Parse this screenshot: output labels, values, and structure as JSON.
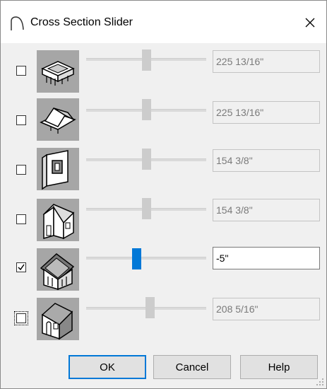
{
  "window": {
    "title": "Cross Section Slider"
  },
  "rows": [
    {
      "value": "225 13/16\"",
      "checked": false,
      "icon": "roof-plan-icon"
    },
    {
      "value": "225 13/16\"",
      "checked": false,
      "icon": "roof-3d-icon"
    },
    {
      "value": "154 3/8\"",
      "checked": false,
      "icon": "wall-section-icon"
    },
    {
      "value": "154 3/8\"",
      "checked": false,
      "icon": "house-side-icon"
    },
    {
      "value": "-5\"",
      "checked": true,
      "icon": "house-front-icon"
    },
    {
      "value": "208 5/16\"",
      "checked": false,
      "icon": "house-cut-icon"
    }
  ],
  "buttons": {
    "ok": "OK",
    "cancel": "Cancel",
    "help": "Help"
  },
  "colors": {
    "accent": "#0078d7",
    "thumb_bg": "#a6a6a6"
  }
}
